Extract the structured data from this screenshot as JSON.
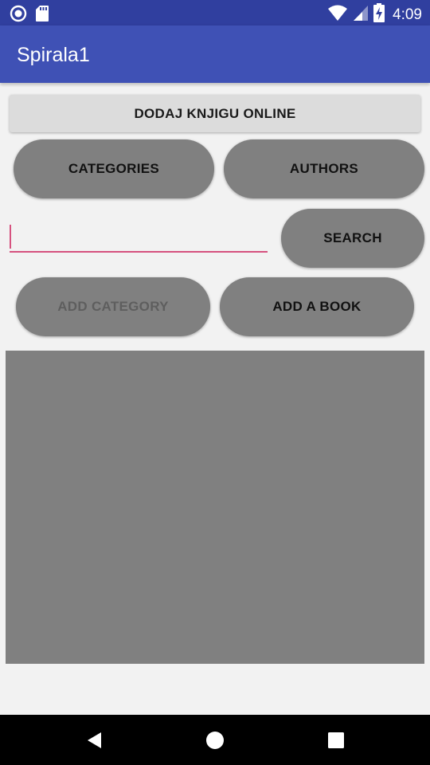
{
  "status_bar": {
    "time": "4:09",
    "icons": [
      "sync-icon",
      "sd-card-icon",
      "wifi-icon",
      "signal-icon",
      "battery-charging-icon"
    ]
  },
  "app_bar": {
    "title": "Spirala1"
  },
  "buttons": {
    "online": "DODAJ KNJIGU ONLINE",
    "categories": "CATEGORIES",
    "authors": "AUTHORS",
    "search": "SEARCH",
    "add_category": "ADD CATEGORY",
    "add_book": "ADD A BOOK"
  },
  "search_field": {
    "value": "",
    "placeholder": ""
  },
  "colors": {
    "status_bar": "#303f9f",
    "app_bar": "#3f51b5",
    "accent": "#d6527f",
    "button_gray": "#808080"
  },
  "nav_bar": {
    "icons": [
      "back-icon",
      "home-icon",
      "recents-icon"
    ]
  }
}
